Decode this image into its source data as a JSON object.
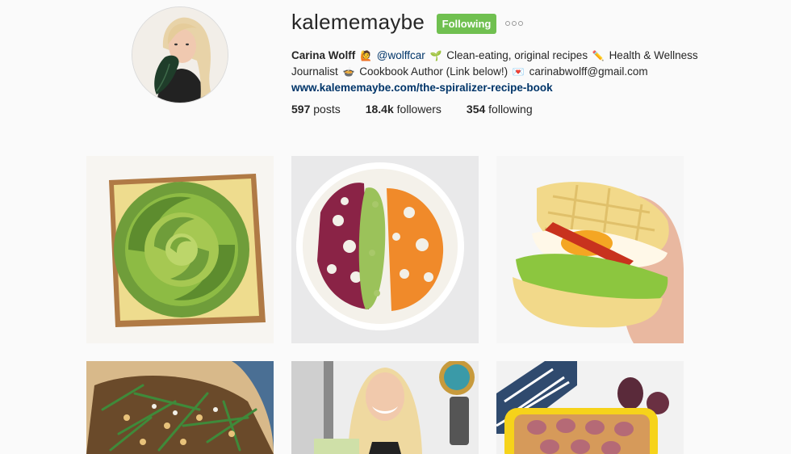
{
  "profile": {
    "username": "kalememaybe",
    "follow_label": "Following",
    "name": "Carina Wolff",
    "mention": "@wolffcar",
    "bio_part1": "Clean-eating, original recipes",
    "bio_part2": "Health & Wellness",
    "bio_part3": "Journalist",
    "bio_part4": "Cookbook Author (Link below!)",
    "email": "carinabwolff@gmail.com",
    "website": "www.kalememaybe.com/the-spiralizer-recipe-book",
    "emojis": {
      "after_name": "🙋",
      "after_mention": "🌱",
      "after_recipes": "✏️",
      "after_journalist": "🍲",
      "after_author": "💌"
    }
  },
  "stats": {
    "posts_count": "597",
    "posts_label": "posts",
    "followers_count": "18.4k",
    "followers_label": "followers",
    "following_count": "354",
    "following_label": "following"
  },
  "posts": [
    {
      "subject": "avocado-rose-toast"
    },
    {
      "subject": "buddha-bowl"
    },
    {
      "subject": "waffle-egg-sandwich"
    },
    {
      "subject": "green-bean-chickpea-salad"
    },
    {
      "subject": "author-with-cookbook"
    },
    {
      "subject": "fig-baked-oatmeal"
    }
  ],
  "colors": {
    "follow_button": "#70c050",
    "link": "#003569",
    "background": "#fafafa"
  }
}
